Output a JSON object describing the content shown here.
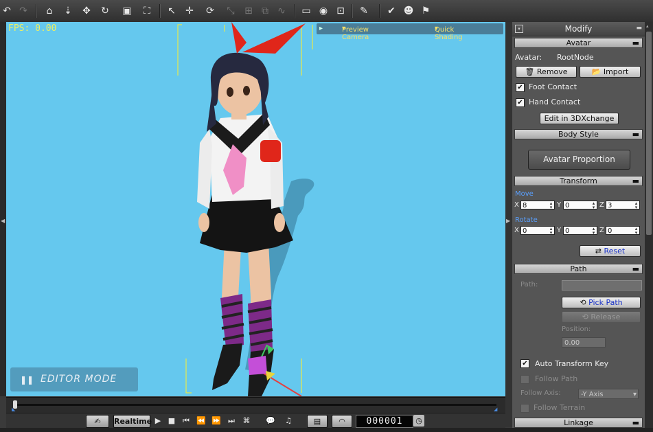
{
  "viewport": {
    "fps_label": "FPS: 0.00",
    "camera": "Preview Camera",
    "shading": "Quick Shading",
    "mode_label": "EDITOR MODE",
    "background": "#65c8ee"
  },
  "toolbar": {
    "icons": [
      "undo-icon",
      "redo-icon",
      "home-icon",
      "down-arrow-icon",
      "move-icon",
      "rotate-view-icon",
      "cube-view-icon",
      "fit-view-icon",
      "select-icon",
      "transform-icon",
      "rotate-icon",
      "scale-icon",
      "align-icon",
      "group-icon",
      "curve-icon",
      "camera-view-icon",
      "eye-icon",
      "screen-icon",
      "brush-icon",
      "check-tool-icon",
      "crowd-icon",
      "flag-icon"
    ]
  },
  "playback": {
    "realtime_label": "Realtime",
    "frame_counter": "000001"
  },
  "panel": {
    "title": "Modify",
    "avatar_section": "Avatar",
    "avatar_label": "Avatar:",
    "avatar_value": "RootNode",
    "remove_label": "Remove",
    "import_label": "Import",
    "foot_contact": "Foot Contact",
    "hand_contact": "Hand Contact",
    "edit_3dx": "Edit in 3DXchange",
    "body_style_section": "Body Style",
    "avatar_proportion": "Avatar Proportion",
    "transform_section": "Transform",
    "move_label": "Move",
    "rotate_label": "Rotate",
    "axis_x": "X",
    "axis_y": "Y",
    "axis_z": "Z",
    "move": {
      "x": "8",
      "y": "0",
      "z": "3"
    },
    "rotate": {
      "x": "0",
      "y": "0",
      "z": "0"
    },
    "reset_label": "Reset",
    "path_section": "Path",
    "path_label": "Path:",
    "pick_path": "Pick Path",
    "release": "Release",
    "position_label": "Position:",
    "position_value": "0.00",
    "auto_transform_key": "Auto Transform Key",
    "follow_path": "Follow Path",
    "follow_axis_label": "Follow Axis:",
    "follow_axis_value": "-Y Axis",
    "follow_terrain": "Follow Terrain",
    "linkage_section": "Linkage"
  }
}
